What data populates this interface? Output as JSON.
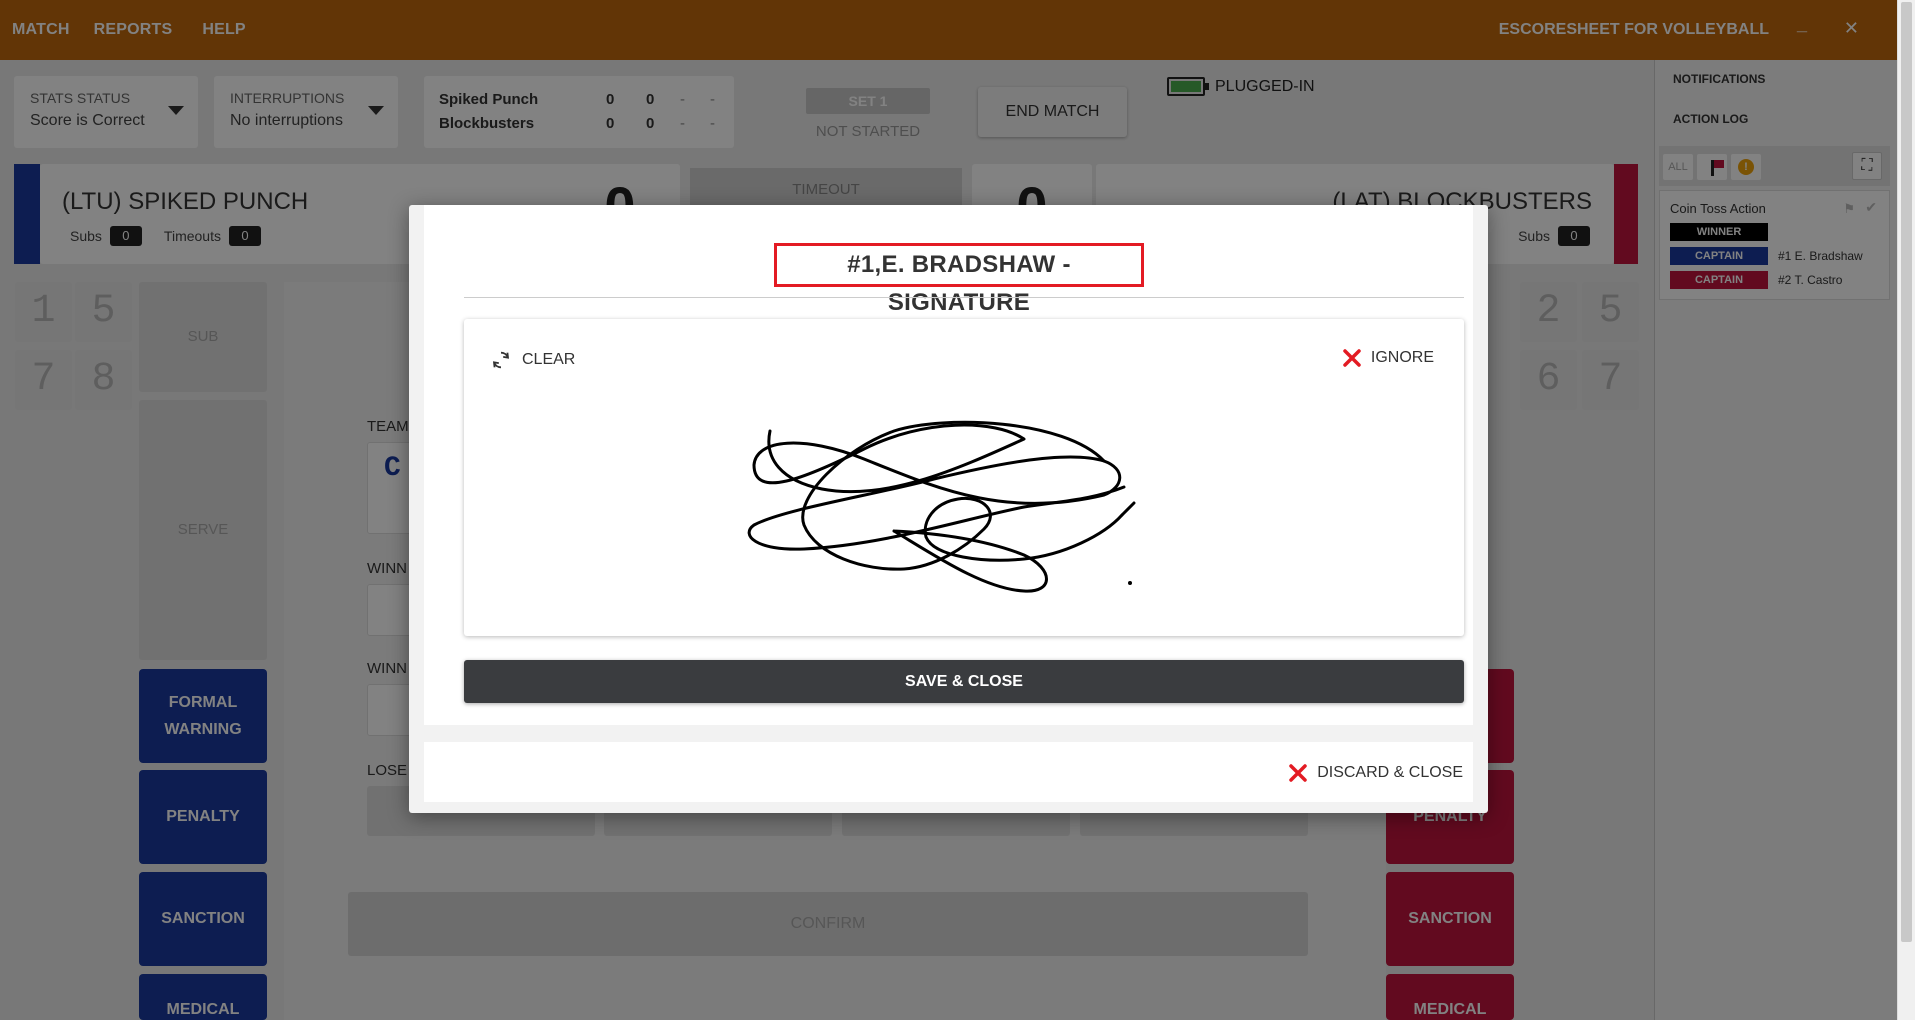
{
  "topbar": {
    "menu": [
      "MATCH",
      "REPORTS",
      "HELP"
    ],
    "app_title": "ESCORESHEET FOR VOLLEYBALL",
    "minimize": "_",
    "close": "✕"
  },
  "stats_status": {
    "label": "STATS STATUS",
    "value": "Score is Correct"
  },
  "interruptions": {
    "label": "INTERRUPTIONS",
    "value": "No interruptions"
  },
  "score_table": {
    "rows": [
      {
        "team": "Spiked Punch",
        "sets": "0",
        "points": "0",
        "d1": "-",
        "d2": "-"
      },
      {
        "team": "Blockbusters",
        "sets": "0",
        "points": "0",
        "d1": "-",
        "d2": "-"
      }
    ]
  },
  "set": {
    "label": "SET 1",
    "status": "NOT STARTED"
  },
  "end_match": "END MATCH",
  "power": {
    "label": "PLUGGED-IN",
    "battery_level": 1.0
  },
  "teams": {
    "left": {
      "name": "(LTU) SPIKED PUNCH",
      "subs_label": "Subs",
      "subs": "0",
      "timeouts_label": "Timeouts",
      "timeouts": "0",
      "score": "0",
      "color": "#1a3aa0",
      "players": [
        "1",
        "5",
        "7",
        "8"
      ]
    },
    "right": {
      "name": "(LAT) BLOCKBUSTERS",
      "subs_label": "Subs",
      "subs": "0",
      "score": "0",
      "color": "#c0153e",
      "players": [
        "2",
        "5",
        "6",
        "7"
      ]
    }
  },
  "timeout": "TIMEOUT",
  "court_buttons": {
    "sub": "SUB",
    "serve": "SERVE"
  },
  "center": {
    "team_label": "TEAM",
    "team_letter": "C",
    "winner_label_1": "WINN",
    "winner_label_2": "WINN",
    "loser_label": "LOSE",
    "confirm": "CONFIRM"
  },
  "actions": {
    "formal_warning": "FORMAL WARNING",
    "penalty": "PENALTY",
    "sanction": "SANCTION",
    "medical": "MEDICAL"
  },
  "right_panel": {
    "notifications": "NOTIFICATIONS",
    "action_log": "ACTION LOG",
    "filter_all": "ALL",
    "log": {
      "title": "Coin Toss Action",
      "winner": "WINNER",
      "captain": "CAPTAIN",
      "captain_left": "#1 E. Bradshaw",
      "captain_right": "#2 T. Castro"
    }
  },
  "modal": {
    "title": "#1,E. BRADSHAW - SIGNATURE",
    "clear": "CLEAR",
    "ignore": "IGNORE",
    "save_close": "SAVE & CLOSE",
    "discard_close": "DISCARD & CLOSE"
  }
}
